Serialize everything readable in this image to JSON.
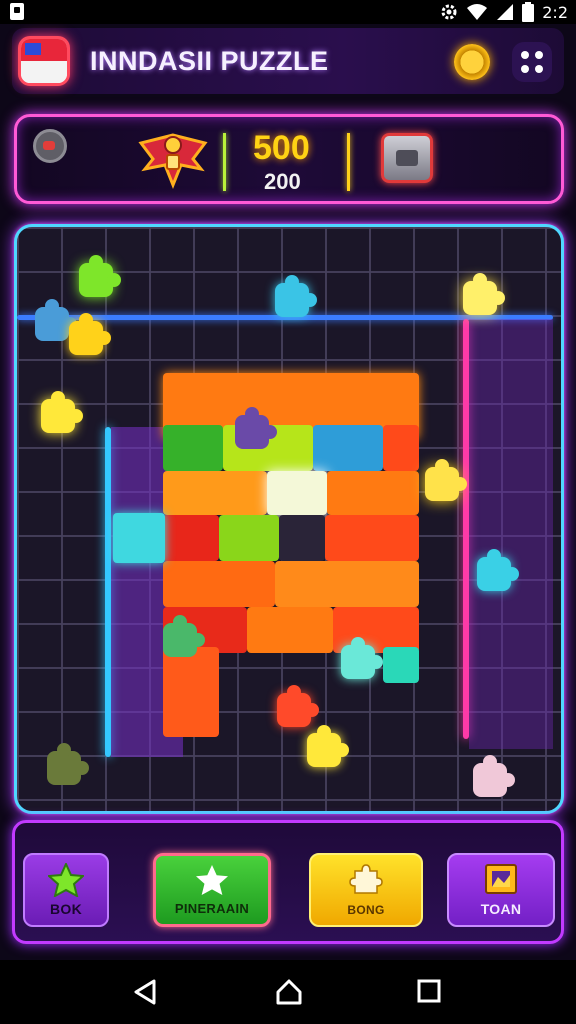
{
  "status_bar": {
    "time": "2:2"
  },
  "header": {
    "title": "INNDASII PUZZLE"
  },
  "score": {
    "main": "500",
    "sub": "200"
  },
  "bottom_buttons": [
    {
      "label": "BOK",
      "icon": "star-icon",
      "color": "#8a35d8"
    },
    {
      "label": "PINERAAIN",
      "icon": "star-icon",
      "color": "#35c02e"
    },
    {
      "label": "BONG",
      "icon": "puzzle-piece-icon",
      "color": "#ffd21a"
    },
    {
      "label": "TOAN",
      "icon": "picture-frame-icon",
      "color": "#9a33e8"
    }
  ],
  "nav_bar": {
    "icons": [
      "back-icon",
      "home-icon",
      "recents-icon"
    ]
  }
}
